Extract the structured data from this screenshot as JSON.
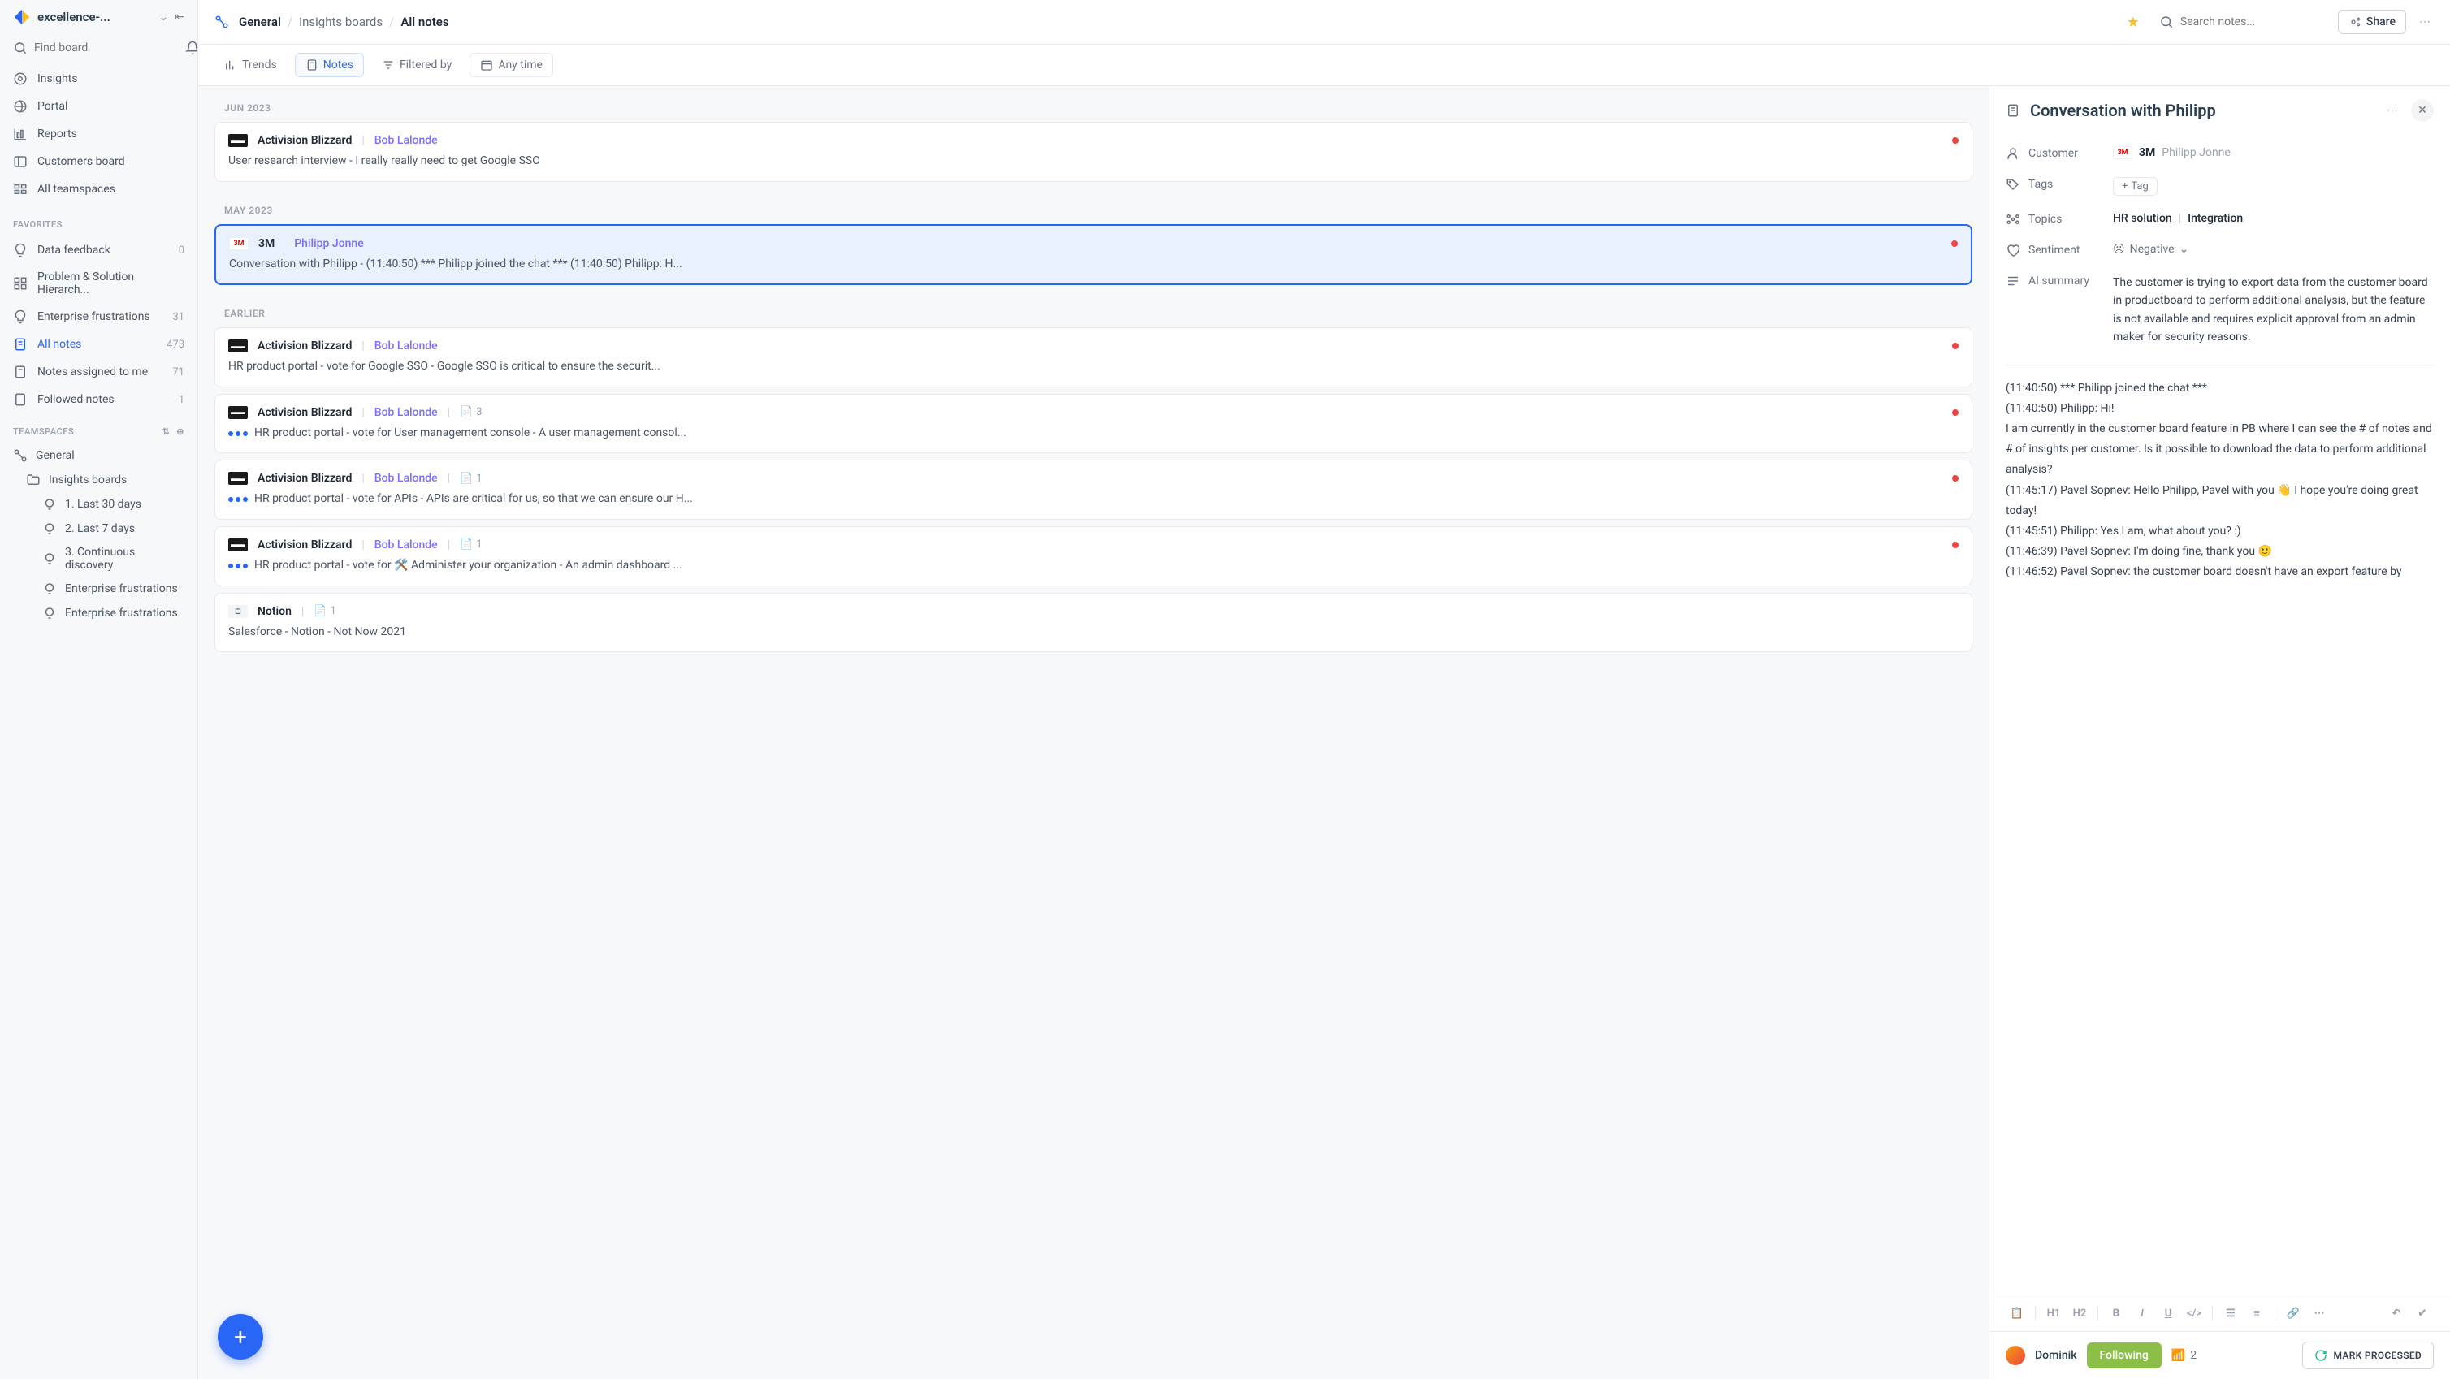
{
  "workspace": "excellence-...",
  "sidebar": {
    "find_board_placeholder": "Find board",
    "nav": [
      {
        "icon": "insights",
        "label": "Insights"
      },
      {
        "icon": "portal",
        "label": "Portal"
      },
      {
        "icon": "reports",
        "label": "Reports"
      },
      {
        "icon": "customers",
        "label": "Customers board"
      },
      {
        "icon": "teamspaces",
        "label": "All teamspaces"
      }
    ],
    "favorites_heading": "FAVORITES",
    "favorites": [
      {
        "icon": "bulb",
        "label": "Data feedback",
        "count": "0"
      },
      {
        "icon": "grid",
        "label": "Problem & Solution Hierarch...",
        "count": ""
      },
      {
        "icon": "bulb",
        "label": "Enterprise frustrations",
        "count": "31"
      },
      {
        "icon": "notes",
        "label": "All notes",
        "count": "473",
        "active": true
      },
      {
        "icon": "notes",
        "label": "Notes assigned to me",
        "count": "71"
      },
      {
        "icon": "notes",
        "label": "Followed notes",
        "count": "1"
      }
    ],
    "teamspaces_heading": "TEAMSPACES",
    "tree": {
      "general": "General",
      "insights_boards": "Insights boards",
      "items": [
        "1. Last 30 days",
        "2. Last 7 days",
        "3. Continuous discovery",
        "Enterprise frustrations",
        "Enterprise frustrations"
      ]
    }
  },
  "topbar": {
    "crumb1": "General",
    "crumb2": "Insights boards",
    "crumb3": "All notes",
    "search_placeholder": "Search notes...",
    "share": "Share"
  },
  "toolbar": {
    "trends": "Trends",
    "notes": "Notes",
    "filtered": "Filtered by",
    "anytime": "Any time"
  },
  "groups": {
    "g0": "JUN 2023",
    "g1": "MAY 2023",
    "g2": "EARLIER"
  },
  "notes": {
    "n0": {
      "company": "Activision Blizzard",
      "author": "Bob Lalonde",
      "body": "User research interview - I really really need to get Google SSO"
    },
    "n1": {
      "company": "3M",
      "author": "Philipp Jonne",
      "body": "Conversation with Philipp - (11:40:50) *** Philipp joined the chat *** (11:40:50) Philipp: H..."
    },
    "n2": {
      "company": "Activision Blizzard",
      "author": "Bob Lalonde",
      "body": "HR product portal - vote for Google SSO - Google SSO is critical to ensure the securit..."
    },
    "n3": {
      "company": "Activision Blizzard",
      "author": "Bob Lalonde",
      "meta": "3",
      "body": "HR product portal - vote for User management console - A user management consol..."
    },
    "n4": {
      "company": "Activision Blizzard",
      "author": "Bob Lalonde",
      "meta": "1",
      "body": "HR product portal - vote for APIs - APIs are critical for us, so that we can ensure our H..."
    },
    "n5": {
      "company": "Activision Blizzard",
      "author": "Bob Lalonde",
      "meta": "1",
      "body": "HR product portal - vote for 🛠️   Administer your organization - An admin dashboard ..."
    },
    "n6": {
      "company": "Notion",
      "meta": "1",
      "body": "Salesforce - Notion - Not Now 2021"
    }
  },
  "detail": {
    "title": "Conversation with Philipp",
    "customer_label": "Customer",
    "customer_company": "3M",
    "customer_person": "Philipp Jonne",
    "tags_label": "Tags",
    "tag_btn": "Tag",
    "topics_label": "Topics",
    "topic1": "HR solution",
    "topic2": "Integration",
    "sentiment_label": "Sentiment",
    "sentiment_value": "Negative",
    "summary_label": "AI summary",
    "summary_text": "The customer is trying to export data from the customer board in productboard to perform additional analysis, but the feature is not available and requires explicit approval from an admin maker for security reasons.",
    "content_lines": [
      "(11:40:50) *** Philipp joined the chat ***",
      "(11:40:50) Philipp: Hi!",
      "I am currently in the customer board feature in PB where I can see the # of notes and # of insights per customer. Is it possible to download the data to perform additional analysis?",
      "(11:45:17) Pavel Sopnev: Hello Philipp, Pavel with you 👋 I hope you're doing great today!",
      "(11:45:51) Philipp: Yes I am, what about you? :)",
      "(11:46:39) Pavel Sopnev: I'm doing fine, thank you 🙂",
      "(11:46:52) Pavel Sopnev: the customer board doesn't have an export feature by"
    ],
    "footer": {
      "owner": "Dominik",
      "following": "Following",
      "followers": "2",
      "mark": "MARK PROCESSED"
    }
  }
}
